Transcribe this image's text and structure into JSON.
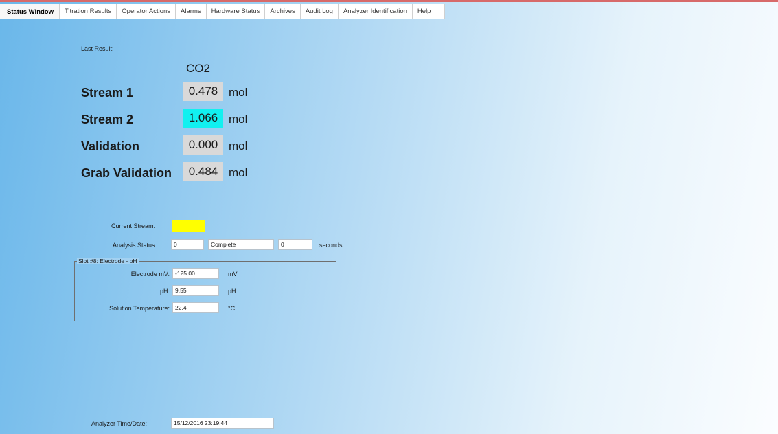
{
  "menu": {
    "active": "Status Window",
    "items": [
      "Titration Results",
      "Operator Actions",
      "Alarms",
      "Hardware Status",
      "Archives",
      "Audit Log",
      "Analyzer Identification",
      "Help"
    ]
  },
  "last_result": {
    "label": "Last Result:",
    "column_header": "CO2",
    "rows": [
      {
        "name": "Stream 1",
        "value": "0.478",
        "unit": "mol",
        "highlight": "#d9d9d9"
      },
      {
        "name": "Stream 2",
        "value": "1.066",
        "unit": "mol",
        "highlight": "#11f0f0"
      },
      {
        "name": "Validation",
        "value": "0.000",
        "unit": "mol",
        "highlight": "#d9d9d9"
      },
      {
        "name": "Grab Validation",
        "value": "0.484",
        "unit": "mol",
        "highlight": "#d9d9d9"
      }
    ]
  },
  "current_stream": {
    "label": "Current Stream:",
    "color": "#ffff00"
  },
  "analysis_status": {
    "label": "Analysis Status:",
    "code": "0",
    "text": "Complete",
    "seconds_value": "0",
    "seconds_unit": "seconds"
  },
  "electrode_group": {
    "legend": "Slot #8: Electrode - pH",
    "rows": [
      {
        "label": "Electrode mV:",
        "value": "-125.00",
        "unit": "mV"
      },
      {
        "label": "pH:",
        "value": "9.55",
        "unit": "pH"
      },
      {
        "label": "Solution Temperature:",
        "value": "22.4",
        "unit": "°C"
      }
    ]
  },
  "analyzer_time": {
    "label": "Analyzer Time/Date:",
    "value": "15/12/2016 23:19:44"
  }
}
